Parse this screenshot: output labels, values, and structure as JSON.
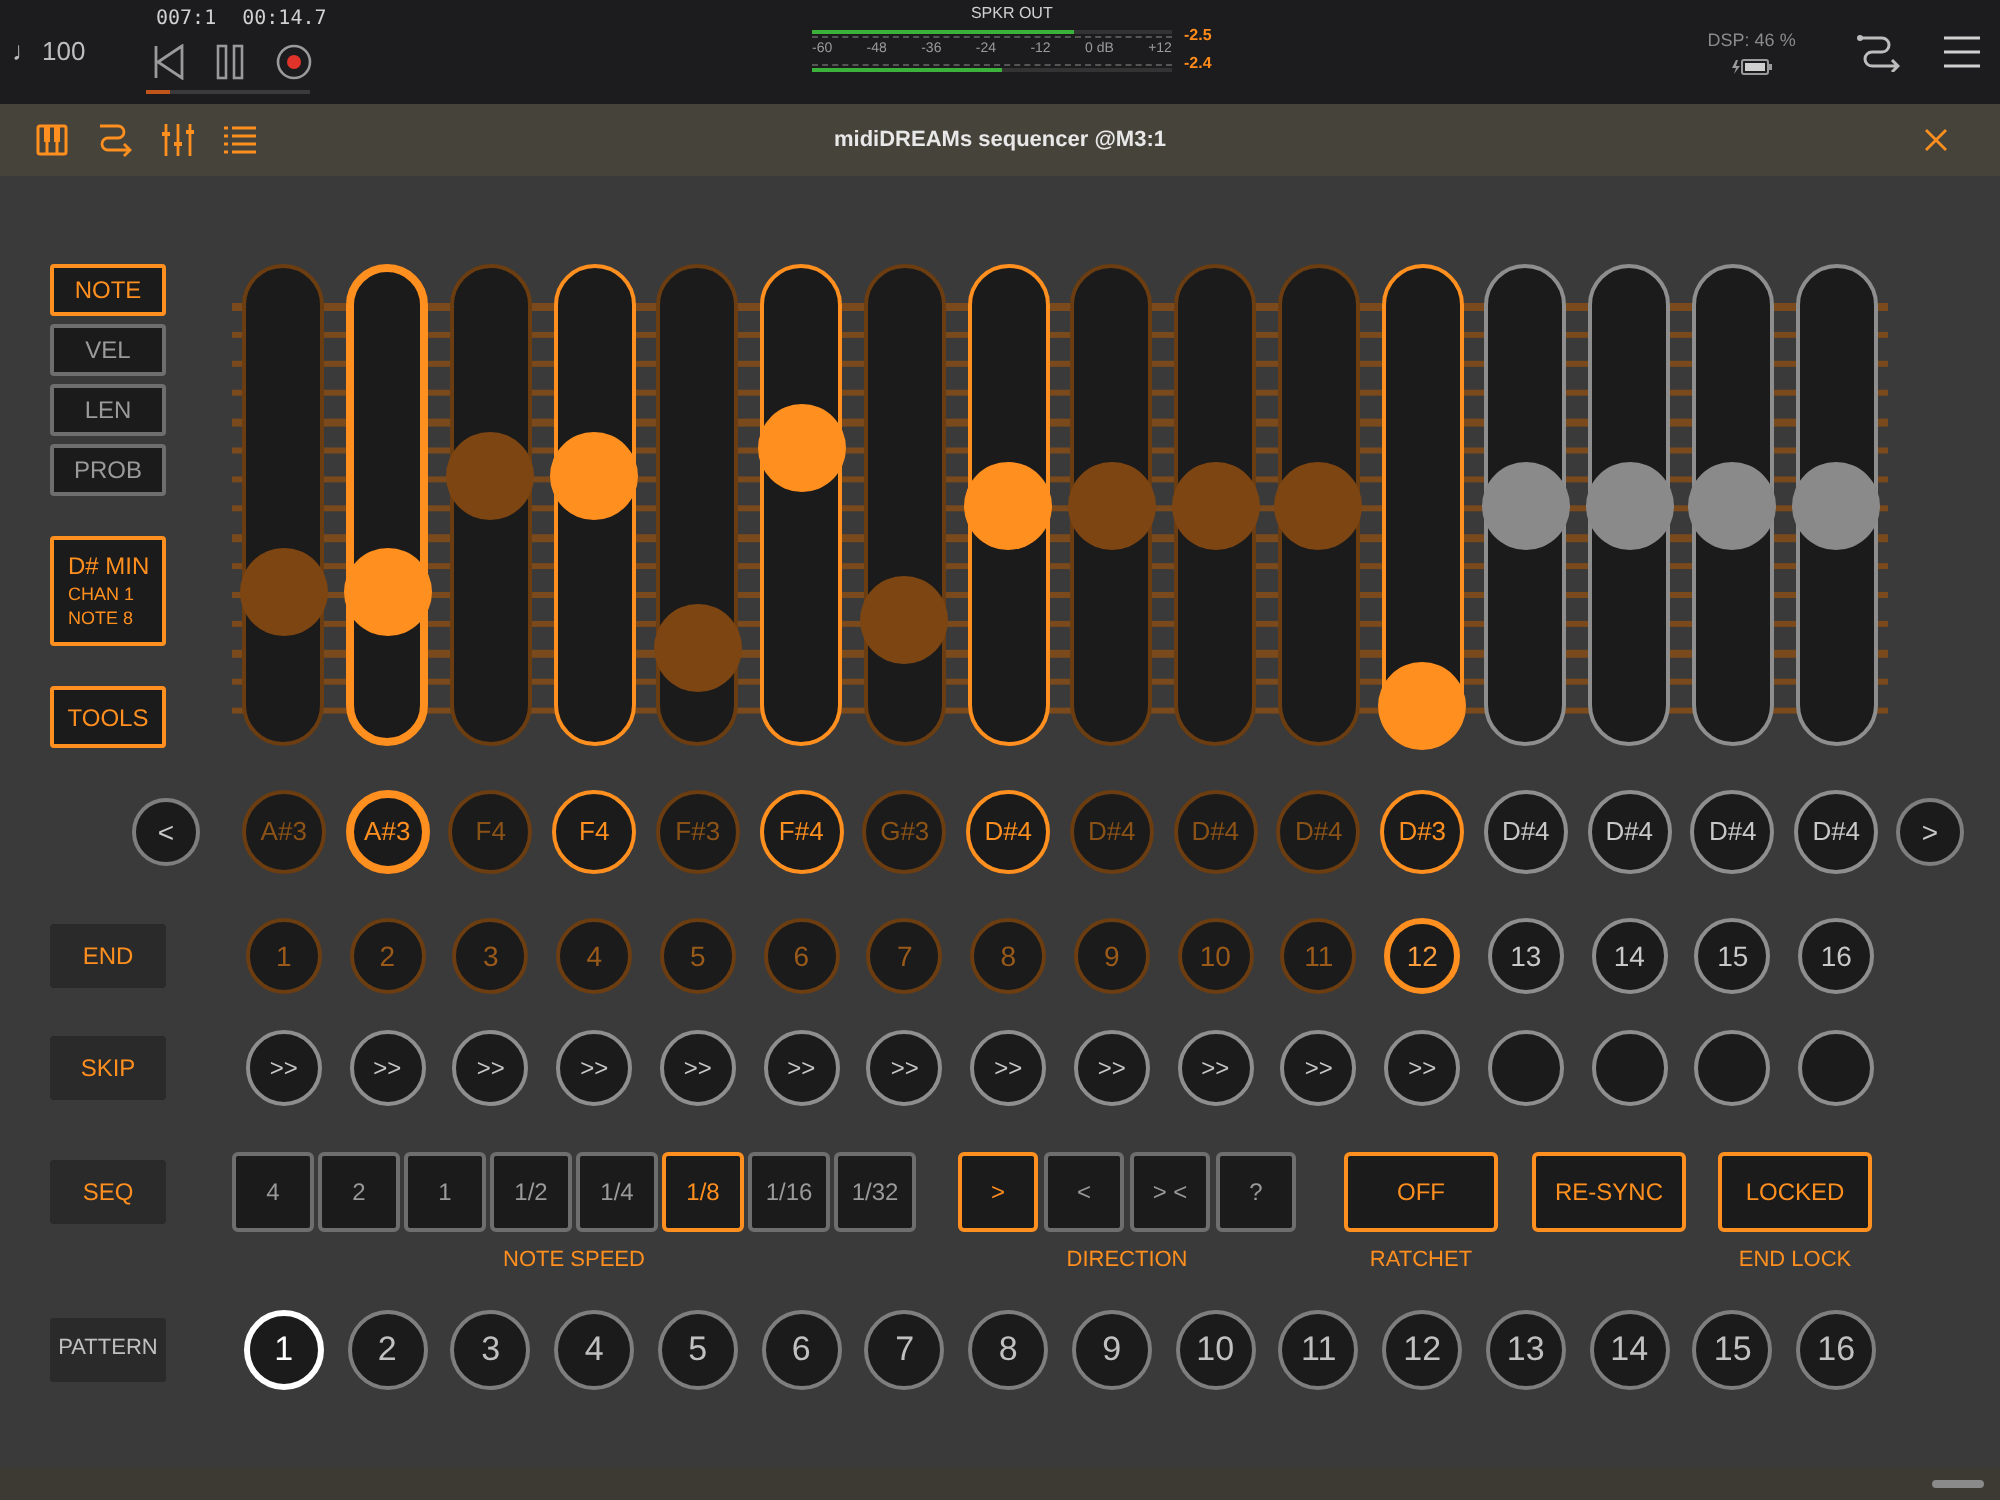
{
  "top_bar": {
    "tempo_glyph": "♩",
    "tempo": "100",
    "position": "007:1",
    "time": "00:14.7",
    "progress": {
      "level": 0.15
    },
    "meter": {
      "title": "SPKR OUT",
      "scale": [
        "-60",
        "-48",
        "-36",
        "-24",
        "-12",
        "0 dB",
        "+12"
      ],
      "channels": [
        {
          "reading": "-2.5",
          "level": 0.73
        },
        {
          "reading": "-2.4",
          "level": 0.53
        }
      ]
    },
    "dsp": "DSP: 46 %"
  },
  "toolbar": {
    "title": "midiDREAMs sequencer @M3:1"
  },
  "modes": [
    {
      "label": "NOTE",
      "selected": true
    },
    {
      "label": "VEL",
      "selected": false
    },
    {
      "label": "LEN",
      "selected": false
    },
    {
      "label": "PROB",
      "selected": false
    }
  ],
  "key_box": {
    "lines": [
      "D# MIN",
      "CHAN 1",
      "NOTE 8"
    ]
  },
  "tools": "TOOLS",
  "nav": {
    "prev": "<",
    "next": ">"
  },
  "steps": [
    {
      "note": "A#3",
      "level": 0.285,
      "in_range": true,
      "on": false,
      "playing": false,
      "end": "1",
      "end_selected": false,
      "skip": ">>"
    },
    {
      "note": "A#3",
      "level": 0.285,
      "in_range": true,
      "on": true,
      "playing": true,
      "end": "2",
      "end_selected": false,
      "skip": ">>"
    },
    {
      "note": "F4",
      "level": 0.575,
      "in_range": true,
      "on": false,
      "playing": false,
      "end": "3",
      "end_selected": false,
      "skip": ">>"
    },
    {
      "note": "F4",
      "level": 0.575,
      "in_range": true,
      "on": true,
      "playing": false,
      "end": "4",
      "end_selected": false,
      "skip": ">>"
    },
    {
      "note": "F#3",
      "level": 0.145,
      "in_range": true,
      "on": false,
      "playing": false,
      "end": "5",
      "end_selected": false,
      "skip": ">>"
    },
    {
      "note": "F#4",
      "level": 0.645,
      "in_range": true,
      "on": true,
      "playing": false,
      "end": "6",
      "end_selected": false,
      "skip": ">>"
    },
    {
      "note": "G#3",
      "level": 0.215,
      "in_range": true,
      "on": false,
      "playing": false,
      "end": "7",
      "end_selected": false,
      "skip": ">>"
    },
    {
      "note": "D#4",
      "level": 0.5,
      "in_range": true,
      "on": true,
      "playing": false,
      "end": "8",
      "end_selected": false,
      "skip": ">>"
    },
    {
      "note": "D#4",
      "level": 0.5,
      "in_range": true,
      "on": false,
      "playing": false,
      "end": "9",
      "end_selected": false,
      "skip": ">>"
    },
    {
      "note": "D#4",
      "level": 0.5,
      "in_range": true,
      "on": false,
      "playing": false,
      "end": "10",
      "end_selected": false,
      "skip": ">>"
    },
    {
      "note": "D#4",
      "level": 0.5,
      "in_range": true,
      "on": false,
      "playing": false,
      "end": "11",
      "end_selected": false,
      "skip": ">>"
    },
    {
      "note": "D#3",
      "level": 0.0,
      "in_range": true,
      "on": true,
      "playing": false,
      "end": "12",
      "end_selected": true,
      "skip": ">>"
    },
    {
      "note": "D#4",
      "level": 0.5,
      "in_range": false,
      "on": false,
      "playing": false,
      "end": "13",
      "end_selected": false
    },
    {
      "note": "D#4",
      "level": 0.5,
      "in_range": false,
      "on": false,
      "playing": false,
      "end": "14",
      "end_selected": false
    },
    {
      "note": "D#4",
      "level": 0.5,
      "in_range": false,
      "on": false,
      "playing": false,
      "end": "15",
      "end_selected": false
    },
    {
      "note": "D#4",
      "level": 0.5,
      "in_range": false,
      "on": false,
      "playing": false,
      "end": "16",
      "end_selected": false
    }
  ],
  "row_labels": {
    "end": "END",
    "skip": "SKIP",
    "seq": "SEQ",
    "pattern": "PATTERN"
  },
  "seq": {
    "note_speed": {
      "label": "NOTE SPEED",
      "options": [
        {
          "label": "4",
          "selected": false
        },
        {
          "label": "2",
          "selected": false
        },
        {
          "label": "1",
          "selected": false
        },
        {
          "label": "1/2",
          "selected": false
        },
        {
          "label": "1/4",
          "selected": false
        },
        {
          "label": "1/8",
          "selected": true
        },
        {
          "label": "1/16",
          "selected": false
        },
        {
          "label": "1/32",
          "selected": false
        }
      ]
    },
    "direction": {
      "label": "DIRECTION",
      "options": [
        {
          "label": ">",
          "selected": true
        },
        {
          "label": "<",
          "selected": false
        },
        {
          "label": "> <",
          "selected": false
        },
        {
          "label": "?",
          "selected": false
        }
      ]
    },
    "ratchet": {
      "label": "RATCHET",
      "value": "OFF"
    },
    "resync": {
      "value": "RE-SYNC"
    },
    "end_lock": {
      "label": "END LOCK",
      "value": "LOCKED"
    }
  },
  "patterns": [
    {
      "label": "1",
      "selected": true
    },
    {
      "label": "2",
      "selected": false
    },
    {
      "label": "3",
      "selected": false
    },
    {
      "label": "4",
      "selected": false
    },
    {
      "label": "5",
      "selected": false
    },
    {
      "label": "6",
      "selected": false
    },
    {
      "label": "7",
      "selected": false
    },
    {
      "label": "8",
      "selected": false
    },
    {
      "label": "9",
      "selected": false
    },
    {
      "label": "10",
      "selected": false
    },
    {
      "label": "11",
      "selected": false
    },
    {
      "label": "12",
      "selected": false
    },
    {
      "label": "13",
      "selected": false
    },
    {
      "label": "14",
      "selected": false
    },
    {
      "label": "15",
      "selected": false
    },
    {
      "label": "16",
      "selected": false
    }
  ]
}
